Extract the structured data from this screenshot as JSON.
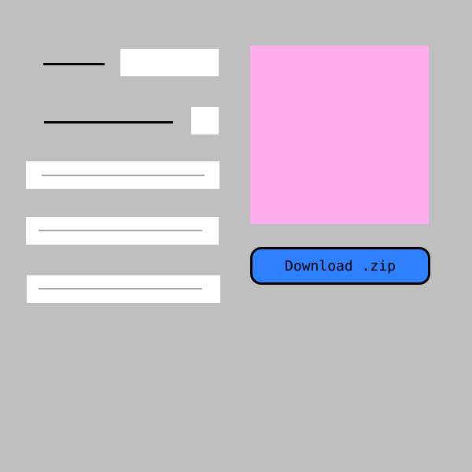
{
  "form": {
    "field1": {
      "value": ""
    },
    "field2": {
      "checked": false
    },
    "field3": {
      "value": ""
    },
    "field4": {
      "value": ""
    },
    "field5": {
      "value": ""
    }
  },
  "preview": {
    "color": "#ffaced"
  },
  "download": {
    "label": "Download .zip",
    "color": "#2e80ff"
  }
}
